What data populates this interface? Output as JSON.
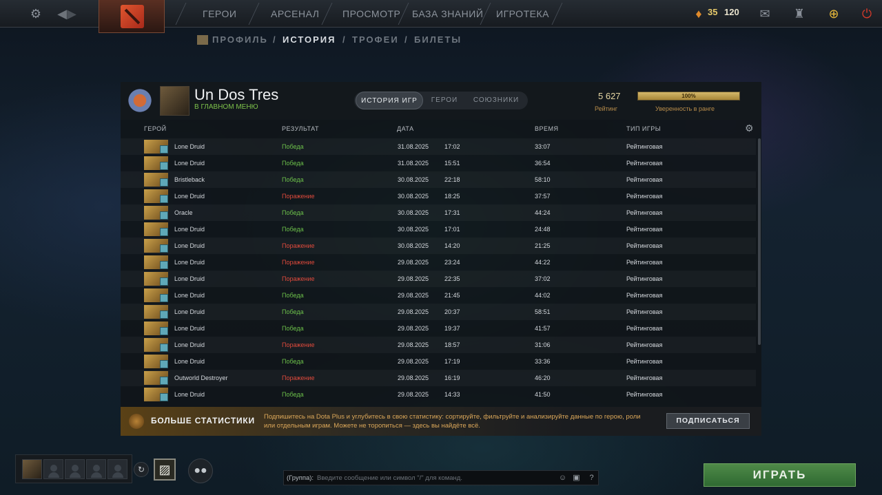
{
  "topbar": {
    "nav": [
      "ГЕРОИ",
      "АРСЕНАЛ",
      "ПРОСМОТР",
      "БАЗА ЗНАНИЙ",
      "ИГРОТЕКА"
    ],
    "shards": "35",
    "level": "120"
  },
  "subnav": {
    "items": [
      "ПРОФИЛЬ",
      "ИСТОРИЯ",
      "ТРОФЕИ",
      "БИЛЕТЫ"
    ],
    "separator": "/"
  },
  "profile": {
    "name": "Un Dos Tres",
    "status": "В ГЛАВНОМ МЕНЮ",
    "tabs": [
      "ИСТОРИЯ ИГР",
      "ГЕРОИ",
      "СОЮЗНИКИ"
    ],
    "rating_value": "5 627",
    "rating_label": "Рейтинг",
    "confidence_value": "100%",
    "confidence_fraction": 1.0,
    "confidence_label": "Уверенность в ранге"
  },
  "table": {
    "headers": [
      "ГЕРОЙ",
      "РЕЗУЛЬТАТ",
      "ДАТА",
      "ВРЕМЯ",
      "ТИП ИГРЫ"
    ],
    "rows": [
      {
        "hero": "Lone Druid",
        "result": "Победа",
        "win": true,
        "date": "31.08.2025",
        "time": "17:02",
        "duration": "33:07",
        "type": "Рейтинговая"
      },
      {
        "hero": "Lone Druid",
        "result": "Победа",
        "win": true,
        "date": "31.08.2025",
        "time": "15:51",
        "duration": "36:54",
        "type": "Рейтинговая"
      },
      {
        "hero": "Bristleback",
        "result": "Победа",
        "win": true,
        "date": "30.08.2025",
        "time": "22:18",
        "duration": "58:10",
        "type": "Рейтинговая"
      },
      {
        "hero": "Lone Druid",
        "result": "Поражение",
        "win": false,
        "date": "30.08.2025",
        "time": "18:25",
        "duration": "37:57",
        "type": "Рейтинговая"
      },
      {
        "hero": "Oracle",
        "result": "Победа",
        "win": true,
        "date": "30.08.2025",
        "time": "17:31",
        "duration": "44:24",
        "type": "Рейтинговая"
      },
      {
        "hero": "Lone Druid",
        "result": "Победа",
        "win": true,
        "date": "30.08.2025",
        "time": "17:01",
        "duration": "24:48",
        "type": "Рейтинговая"
      },
      {
        "hero": "Lone Druid",
        "result": "Поражение",
        "win": false,
        "date": "30.08.2025",
        "time": "14:20",
        "duration": "21:25",
        "type": "Рейтинговая"
      },
      {
        "hero": "Lone Druid",
        "result": "Поражение",
        "win": false,
        "date": "29.08.2025",
        "time": "23:24",
        "duration": "44:22",
        "type": "Рейтинговая"
      },
      {
        "hero": "Lone Druid",
        "result": "Поражение",
        "win": false,
        "date": "29.08.2025",
        "time": "22:35",
        "duration": "37:02",
        "type": "Рейтинговая"
      },
      {
        "hero": "Lone Druid",
        "result": "Победа",
        "win": true,
        "date": "29.08.2025",
        "time": "21:45",
        "duration": "44:02",
        "type": "Рейтинговая"
      },
      {
        "hero": "Lone Druid",
        "result": "Победа",
        "win": true,
        "date": "29.08.2025",
        "time": "20:37",
        "duration": "58:51",
        "type": "Рейтинговая"
      },
      {
        "hero": "Lone Druid",
        "result": "Победа",
        "win": true,
        "date": "29.08.2025",
        "time": "19:37",
        "duration": "41:57",
        "type": "Рейтинговая"
      },
      {
        "hero": "Lone Druid",
        "result": "Поражение",
        "win": false,
        "date": "29.08.2025",
        "time": "18:57",
        "duration": "31:06",
        "type": "Рейтинговая"
      },
      {
        "hero": "Lone Druid",
        "result": "Победа",
        "win": true,
        "date": "29.08.2025",
        "time": "17:19",
        "duration": "33:36",
        "type": "Рейтинговая"
      },
      {
        "hero": "Outworld Destroyer",
        "result": "Поражение",
        "win": false,
        "date": "29.08.2025",
        "time": "16:19",
        "duration": "46:20",
        "type": "Рейтинговая"
      },
      {
        "hero": "Lone Druid",
        "result": "Победа",
        "win": true,
        "date": "29.08.2025",
        "time": "14:33",
        "duration": "41:50",
        "type": "Рейтинговая"
      }
    ]
  },
  "promo": {
    "title": "БОЛЬШЕ СТАТИСТИКИ",
    "text": "Подпишитесь на Dota Plus и углубитесь в свою статистику: сортируйте, фильтруйте и анализируйте данные по герою, роли или отдельным играм. Можете не торопиться — здесь вы найдёте всё.",
    "button": "ПОДПИСАТЬСЯ"
  },
  "chat": {
    "label": "(Группа):",
    "placeholder": "Введите сообщение или символ \"/\" для команд."
  },
  "play_button": "ИГРАТЬ",
  "colors": {
    "win": "#6cc04a",
    "loss": "#e04a3c",
    "accent_gold": "#e6c96a",
    "play_green": "#3f7a3e"
  },
  "icons": [
    "gear-icon",
    "arrow-left-icon",
    "arrow-right-icon",
    "dota-logo-icon",
    "shard-icon",
    "mail-icon",
    "armory-icon",
    "dota-plus-icon",
    "power-icon",
    "rank-medal-icon",
    "settings-icon",
    "party-icon",
    "emoji-icon",
    "chat-settings-icon",
    "help-icon"
  ]
}
